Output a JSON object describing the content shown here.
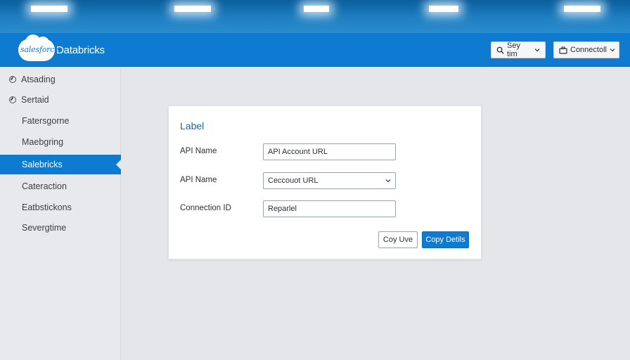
{
  "header": {
    "logo_text": "salesforce",
    "app_name": "Databricks",
    "search_button": {
      "label": "Sey tim",
      "icon": "search-icon"
    },
    "connect_button": {
      "label": "Connectoll",
      "icon": "connection-icon"
    },
    "colors": {
      "header": "#0f7bd0",
      "accent": "#0f7bd0"
    }
  },
  "sidebar": {
    "items": [
      {
        "label": "Atsading",
        "icon": "circle-icon"
      },
      {
        "label": "Sertaid",
        "icon": "circle-icon"
      },
      {
        "label": "Fatersgorne"
      },
      {
        "label": "Maebgring"
      },
      {
        "label": "Salebricks",
        "active": true
      },
      {
        "label": "Cateraction"
      },
      {
        "label": "Eatbstickons"
      },
      {
        "label": "Severgtime"
      }
    ]
  },
  "form": {
    "title": "Label",
    "fields": [
      {
        "label": "API Name",
        "value": "API Account URL"
      },
      {
        "label": "API Name",
        "value": "Ceccouot URL"
      },
      {
        "label": "Connection ID",
        "value": "Reparlel"
      }
    ],
    "secondary_button": "Coy Uve",
    "primary_button": "Copy Detils"
  }
}
